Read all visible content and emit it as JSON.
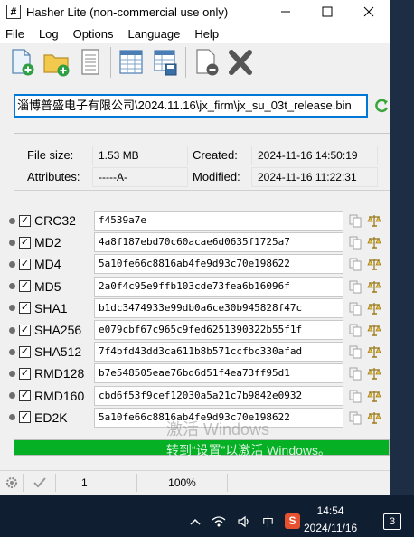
{
  "window": {
    "title": "Hasher Lite (non-commercial use only)",
    "icon": "hash-icon",
    "controls": [
      "minimize-icon",
      "maximize-icon",
      "close-icon"
    ]
  },
  "menu": {
    "items": [
      "File",
      "Log",
      "Options",
      "Language",
      "Help"
    ]
  },
  "toolbar": {
    "buttons": [
      "add-file-icon",
      "add-folder-icon",
      "document-icon",
      "table-icon",
      "save-table-icon",
      "remove-file-icon",
      "delete-icon"
    ]
  },
  "path": {
    "value": "淄博普盛电子有限公司\\2024.11.16\\jx_firm\\jx_su_03t_release.bin",
    "refresh_icon": "refresh-icon"
  },
  "file_info": {
    "file_size_label": "File size:",
    "file_size": "1.53 MB",
    "attributes_label": "Attributes:",
    "attributes": "-----A-",
    "created_label": "Created:",
    "created": "2024-11-16 14:50:19",
    "modified_label": "Modified:",
    "modified": "2024-11-16 11:22:31"
  },
  "hashes": [
    {
      "name": "CRC32",
      "value": "f4539a7e",
      "checked": "✓"
    },
    {
      "name": "MD2",
      "value": "4a8f187ebd70c60acae6d0635f1725a7",
      "checked": "✓"
    },
    {
      "name": "MD4",
      "value": "5a10fe66c8816ab4fe9d93c70e198622",
      "checked": "✓"
    },
    {
      "name": "MD5",
      "value": "2a0f4c95e9ffb103cde73fea6b16096f",
      "checked": "✓"
    },
    {
      "name": "SHA1",
      "value": "b1dc3474933e99db0a6ce30b945828f47c",
      "checked": "✓"
    },
    {
      "name": "SHA256",
      "value": "e079cbf67c965c9fed6251390322b55f1f",
      "checked": "✓"
    },
    {
      "name": "SHA512",
      "value": "7f4bfd43dd3ca611b8b571ccfbc330afad",
      "checked": "✓"
    },
    {
      "name": "RMD128",
      "value": "b7e548505eae76bd6d51f4ea73ff95d1",
      "checked": "✓"
    },
    {
      "name": "RMD160",
      "value": "cbd6f53f9cef12030a5a21c7b9842e0932",
      "checked": "✓"
    },
    {
      "name": "ED2K",
      "value": "5a10fe66c8816ab4fe9d93c70e198622",
      "checked": "✓"
    }
  ],
  "progress": {
    "percent": 100,
    "color": "#06b025"
  },
  "watermark": {
    "line1": "激活 Windows",
    "line2": "转到“设置”以激活 Windows。"
  },
  "statusbar": {
    "gear_icon": "gear-icon",
    "check_icon": "check-icon",
    "count": "1",
    "zoom": "100%"
  },
  "taskbar": {
    "tray_icons": [
      "chevron-up-icon",
      "wifi-icon",
      "speaker-icon"
    ],
    "ime": "中",
    "app_badge": "S",
    "time": "14:54",
    "date": "2024/11/16",
    "notifications": "3"
  }
}
